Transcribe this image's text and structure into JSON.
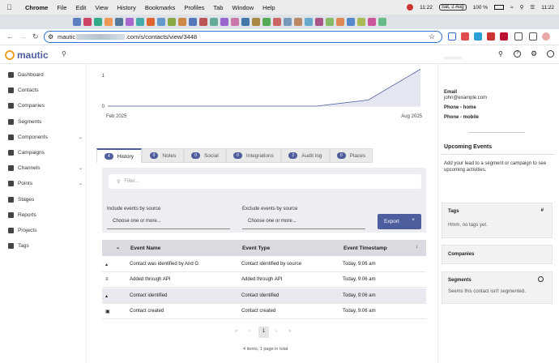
{
  "menubar": {
    "app": "Chrome",
    "items": [
      "File",
      "Edit",
      "View",
      "History",
      "Bookmarks",
      "Profiles",
      "Tab",
      "Window",
      "Help"
    ],
    "time1": "11:22",
    "date": "Sat, 2 Aug",
    "battery": "100 %",
    "time2": "11:22"
  },
  "browser": {
    "url_prefix": "mautic",
    "url_suffix": ".com/s/contacts/view/3448"
  },
  "app": {
    "logo_text": "mautic"
  },
  "sidebar": {
    "items": [
      {
        "label": "Dashboard",
        "chevron": false
      },
      {
        "label": "Contacts",
        "chevron": false
      },
      {
        "label": "Companies",
        "chevron": false
      },
      {
        "label": "Segments",
        "chevron": false
      },
      {
        "label": "Components",
        "chevron": true
      },
      {
        "label": "Campaigns",
        "chevron": false
      },
      {
        "label": "Channels",
        "chevron": true
      },
      {
        "label": "Points",
        "chevron": true
      },
      {
        "label": "Stages",
        "chevron": false
      },
      {
        "label": "Reports",
        "chevron": false
      },
      {
        "label": "Projects",
        "chevron": false
      },
      {
        "label": "Tags",
        "chevron": false
      }
    ]
  },
  "chart_data": {
    "type": "area",
    "x": [
      "Feb 2025",
      "Mar 2025",
      "Apr 2025",
      "May 2025",
      "Jun 2025",
      "Jul 2025",
      "Aug 2025"
    ],
    "values": [
      0,
      0,
      0,
      0,
      0,
      0.2,
      1.2
    ],
    "yticks": [
      "0",
      "1"
    ],
    "xlabels": [
      "Feb 2025",
      "Aug 2025"
    ],
    "ylim": [
      0,
      1.3
    ],
    "color": "#4e5d9d"
  },
  "tabs": [
    {
      "count": "4",
      "label": "History",
      "active": true
    },
    {
      "count": "0",
      "label": "Notes",
      "active": false
    },
    {
      "count": "0",
      "label": "Social",
      "active": false
    },
    {
      "count": "0",
      "label": "Integrations",
      "active": false
    },
    {
      "count": "2",
      "label": "Audit log",
      "active": false
    },
    {
      "count": "0",
      "label": "Places",
      "active": false
    }
  ],
  "filter": {
    "placeholder": "Filter...",
    "include_label": "Include events by source",
    "include_placeholder": "Choose one or more...",
    "exclude_label": "Exclude events by source",
    "exclude_placeholder": "Choose one or more...",
    "export_label": "Export"
  },
  "table": {
    "headers": [
      "Event Name",
      "Event Type",
      "Event Timestamp"
    ],
    "rows": [
      {
        "name": "Contact was identified by And G",
        "type": "Contact identified by source",
        "time": "Today, 9:06 am"
      },
      {
        "name": "Added through API",
        "type": "Added through API",
        "time": "Today, 9:06 am"
      },
      {
        "name": "Contact identified",
        "type": "Contact identified",
        "time": "Today, 9:06 am"
      },
      {
        "name": "Contact created",
        "type": "Contact created",
        "time": "Today, 9:06 am"
      }
    ]
  },
  "pagination": {
    "page": "1",
    "summary": "4 items, 1 page in total"
  },
  "contact": {
    "email_label": "Email",
    "email": "john@example.com",
    "phone_home": "Phone - home",
    "phone_mobile": "Phone - mobile"
  },
  "upcoming": {
    "title": "Upcoming Events",
    "text": "Add your lead to a segment or campaign to see upcoming activities."
  },
  "tags_panel": {
    "title": "Tags",
    "empty": "Hmm, no tags yet."
  },
  "companies_panel": {
    "title": "Companies"
  },
  "segments_panel": {
    "title": "Segments",
    "empty": "Seems this contact isn't segmented."
  }
}
